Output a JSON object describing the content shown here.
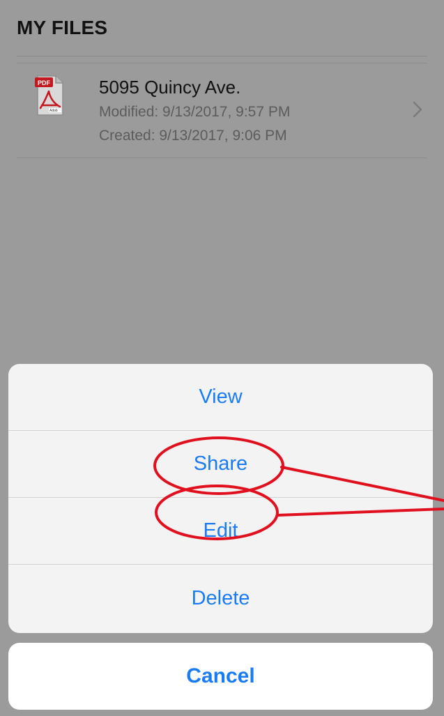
{
  "header": {
    "title": "MY FILES"
  },
  "files": [
    {
      "name": "5095 Quincy Ave.",
      "modified": "Modified: 9/13/2017, 9:57 PM",
      "created": "Created: 9/13/2017, 9:06 PM",
      "icon": "pdf-file-icon"
    }
  ],
  "action_sheet": {
    "actions": [
      "View",
      "Share",
      "Edit",
      "Delete"
    ],
    "cancel_label": "Cancel"
  },
  "colors": {
    "accent": "#1a7cf5",
    "annotation": "#e0101e",
    "dim_overlay": "#9b9b9b"
  }
}
